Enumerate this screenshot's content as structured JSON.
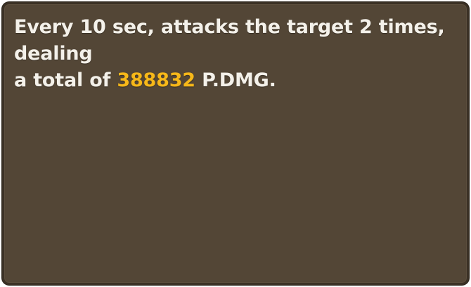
{
  "tooltip": {
    "line1": "Every 10 sec, attacks the target 2 times, dealing",
    "prefix": "a total of",
    "damage_value": "388832",
    "suffix": "P.DMG.",
    "colors": {
      "background": "#534636",
      "border": "#3b3125",
      "text": "#f4f1ea",
      "highlight": "#f7b819"
    }
  }
}
